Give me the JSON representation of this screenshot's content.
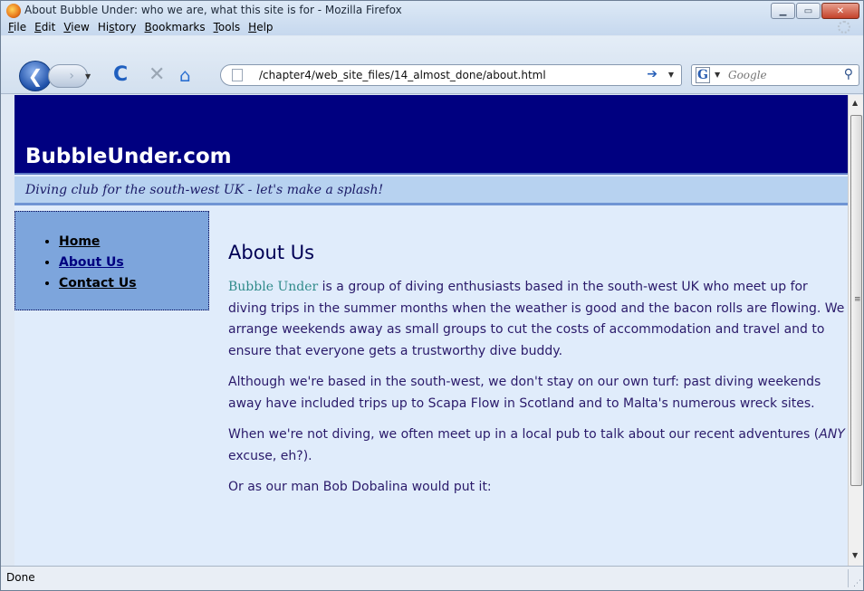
{
  "window": {
    "title": "About Bubble Under: who we are, what this site is for - Mozilla Firefox",
    "buttons": {
      "minimize": "▁",
      "maximize": "▭",
      "close": "✕"
    }
  },
  "menu": {
    "items": [
      {
        "accel": "F",
        "rest": "ile"
      },
      {
        "accel": "E",
        "rest": "dit"
      },
      {
        "accel": "V",
        "rest": "iew"
      },
      {
        "pre": "Hi",
        "accel": "s",
        "rest": "tory"
      },
      {
        "accel": "B",
        "rest": "ookmarks"
      },
      {
        "accel": "T",
        "rest": "ools"
      },
      {
        "accel": "H",
        "rest": "elp"
      }
    ]
  },
  "toolbar": {
    "back_icon": "❮",
    "forward_icon": "›",
    "dropdown_icon": "▼",
    "reload_icon": "C",
    "stop_icon": "✕",
    "home_icon": "⌂",
    "url": "/chapter4/web_site_files/14_almost_done/about.html",
    "go_icon": "➔",
    "search_engine_label": "G",
    "search_placeholder": "Google",
    "search_icon": "⚲"
  },
  "page": {
    "site_title": "BubbleUnder.com",
    "tagline": "Diving club for the south-west UK - let's make a splash!",
    "nav": [
      {
        "label": "Home"
      },
      {
        "label": "About Us"
      },
      {
        "label": "Contact Us"
      }
    ],
    "heading": "About Us",
    "para1_brand": "Bubble Under",
    "para1_rest": " is a group of diving enthusiasts based in the south-west UK who meet up for diving trips in the summer months when the weather is good and the bacon rolls are flowing. We arrange weekends away as small groups to cut the costs of accommodation and travel and to ensure that everyone gets a trustworthy dive buddy.",
    "para2": "Although we're based in the south-west, we don't stay on our own turf: past diving weekends away have included trips up to Scapa Flow in Scotland and to Malta's numerous wreck sites.",
    "para3_a": "When we're not diving, we often meet up in a local pub to talk about our recent adventures (",
    "para3_em": "ANY",
    "para3_b": " excuse, eh?).",
    "para4": "Or as our man Bob Dobalina would put it:"
  },
  "scrollbar": {
    "up": "▲",
    "down": "▼",
    "grip": "≡"
  },
  "status": {
    "text": "Done",
    "grip": "⋰"
  }
}
